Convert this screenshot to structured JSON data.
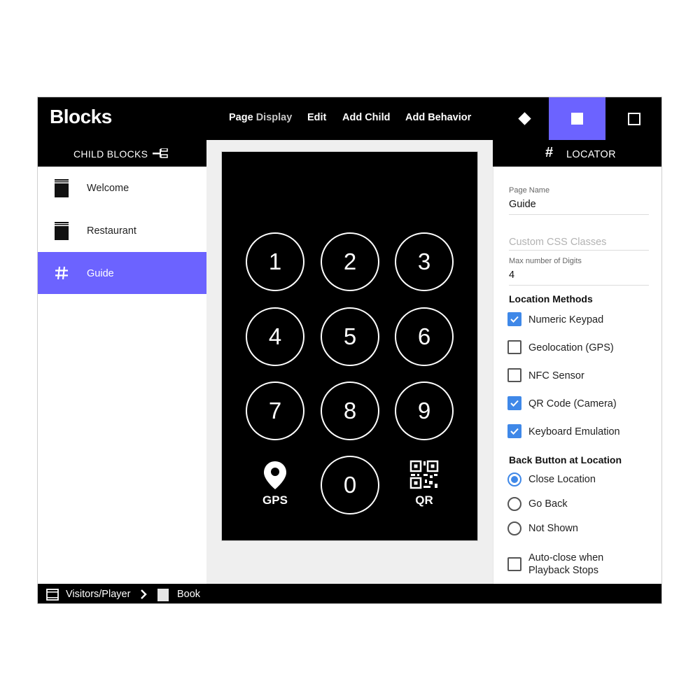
{
  "app": {
    "logo": "Blocks"
  },
  "menu": {
    "page_label": "Page",
    "display_label": "Display",
    "edit_label": "Edit",
    "add_child_label": "Add Child",
    "add_behavior_label": "Add Behavior"
  },
  "view_modes": [
    {
      "name": "diamond",
      "active": false
    },
    {
      "name": "filled-square",
      "active": true
    },
    {
      "name": "outline-square",
      "active": false
    }
  ],
  "left_panel": {
    "title": "CHILD BLOCKS",
    "items": [
      {
        "label": "Welcome",
        "icon": "book-icon",
        "selected": false
      },
      {
        "label": "Restaurant",
        "icon": "book-icon",
        "selected": false
      },
      {
        "label": "Guide",
        "icon": "hash-icon",
        "selected": true
      }
    ]
  },
  "keypad": {
    "keys": [
      "1",
      "2",
      "3",
      "4",
      "5",
      "6",
      "7",
      "8",
      "9",
      "0"
    ],
    "gps_label": "GPS",
    "qr_label": "QR"
  },
  "right_panel": {
    "title": "LOCATOR",
    "page_name_label": "Page Name",
    "page_name_value": "Guide",
    "css_classes_placeholder": "Custom CSS Classes",
    "max_digits_label": "Max number of Digits",
    "max_digits_value": "4",
    "location_methods_title": "Location Methods",
    "location_methods": [
      {
        "label": "Numeric Keypad",
        "checked": true
      },
      {
        "label": "Geolocation (GPS)",
        "checked": false
      },
      {
        "label": "NFC Sensor",
        "checked": false
      },
      {
        "label": "QR Code (Camera)",
        "checked": true
      },
      {
        "label": "Keyboard Emulation",
        "checked": true
      }
    ],
    "back_button_title": "Back Button at Location",
    "back_button_options": [
      {
        "label": "Close Location",
        "selected": true
      },
      {
        "label": "Go Back",
        "selected": false
      },
      {
        "label": "Not Shown",
        "selected": false
      }
    ],
    "auto_close_line1": "Auto-close when",
    "auto_close_line2": "Playback Stops",
    "auto_close_checked": false
  },
  "breadcrumb": {
    "first": "Visitors/Player",
    "second": "Book"
  },
  "colors": {
    "accent": "#6c63ff",
    "check": "#3f88e8",
    "bar": "#000000"
  }
}
